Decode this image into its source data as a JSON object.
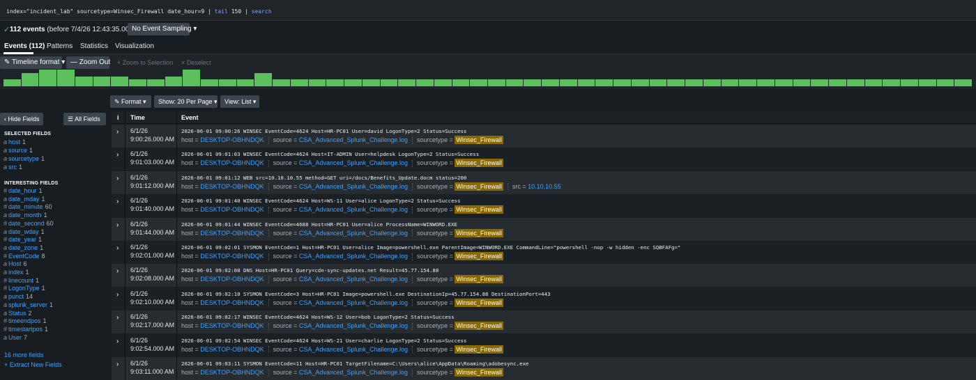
{
  "search": {
    "query": "index=\"incident_lab\" sourcetype=Winsec_Firewall date_hour=9 | ",
    "cmd1": "tail",
    "arg1": " 150 | ",
    "cmd2": "search"
  },
  "status": {
    "count_bold": "112 events",
    "count_rest": " (before 7/4/26 12:43:35.000 PM)",
    "sampling": "No Event Sampling ▾"
  },
  "tabs": [
    {
      "label": "Events (112)"
    },
    {
      "label": "Patterns"
    },
    {
      "label": "Statistics"
    },
    {
      "label": "Visualization"
    }
  ],
  "timeline": {
    "format": "Timeline format ▾",
    "zoom_out": "Zoom Out",
    "zoom_sel": "+ Zoom to Selection",
    "deselect": "× Deselect",
    "counts": [
      2,
      4,
      5,
      5,
      3,
      3,
      3,
      2,
      2,
      3,
      5,
      2,
      2,
      2,
      4,
      2,
      2,
      2,
      2,
      2,
      2,
      2,
      2,
      2,
      2,
      2,
      2,
      2,
      2,
      2,
      2,
      2,
      2,
      2,
      2,
      2,
      2,
      2,
      2,
      2,
      2,
      2,
      2,
      2,
      2,
      2,
      2,
      2,
      2,
      2,
      2,
      2,
      2,
      2
    ]
  },
  "toolbar": {
    "format": "Format ▾",
    "per_page": "Show: 20 Per Page ▾",
    "view": "View: List ▾"
  },
  "sidebar": {
    "hide": "Hide Fields",
    "all": "All Fields",
    "selected_heading": "SELECTED FIELDS",
    "selected": [
      {
        "type": "a",
        "name": "host",
        "count": "1"
      },
      {
        "type": "a",
        "name": "source",
        "count": "1"
      },
      {
        "type": "a",
        "name": "sourcetype",
        "count": "1"
      },
      {
        "type": "a",
        "name": "src",
        "count": "1"
      }
    ],
    "interesting_heading": "INTERESTING FIELDS",
    "interesting": [
      {
        "type": "#",
        "name": "date_hour",
        "count": "1"
      },
      {
        "type": "a",
        "name": "date_mday",
        "count": "1"
      },
      {
        "type": "#",
        "name": "date_minute",
        "count": "60"
      },
      {
        "type": "a",
        "name": "date_month",
        "count": "1"
      },
      {
        "type": "#",
        "name": "date_second",
        "count": "60"
      },
      {
        "type": "a",
        "name": "date_wday",
        "count": "1"
      },
      {
        "type": "#",
        "name": "date_year",
        "count": "1"
      },
      {
        "type": "a",
        "name": "date_zone",
        "count": "1"
      },
      {
        "type": "#",
        "name": "EventCode",
        "count": "8"
      },
      {
        "type": "a",
        "name": "Host",
        "count": "6"
      },
      {
        "type": "a",
        "name": "index",
        "count": "1"
      },
      {
        "type": "#",
        "name": "linecount",
        "count": "1"
      },
      {
        "type": "#",
        "name": "LogonType",
        "count": "1"
      },
      {
        "type": "a",
        "name": "punct",
        "count": "14"
      },
      {
        "type": "a",
        "name": "splunk_server",
        "count": "1"
      },
      {
        "type": "a",
        "name": "Status",
        "count": "2"
      },
      {
        "type": "#",
        "name": "timeendpos",
        "count": "1"
      },
      {
        "type": "#",
        "name": "timestartpos",
        "count": "1"
      },
      {
        "type": "a",
        "name": "User",
        "count": "7"
      }
    ],
    "more": "16 more fields",
    "extract": "+ Extract New Fields"
  },
  "table": {
    "col_i": "i",
    "col_time": "Time",
    "col_event": "Event",
    "meta_host_label": "host = ",
    "meta_source_label": "source = ",
    "meta_sourcetype_label": "sourcetype = ",
    "meta_src_label": "src = ",
    "host": "DESKTOP-OBHNDQK",
    "source": "CSA_Advanced_Splunk_Challenge.log",
    "sourcetype": "Winsec_Firewall",
    "rows": [
      {
        "date": "6/1/26",
        "time": "9:00:26.000 AM",
        "raw": "2026-06-01 09:00:26 WINSEC EventCode=4624 Host=HR-PC01 User=david LogonType=2 Status=Success"
      },
      {
        "date": "6/1/26",
        "time": "9:01:03.000 AM",
        "raw": "2026-06-01 09:01:03 WINSEC EventCode=4624 Host=IT-ADMIN User=helpdesk LogonType=2 Status=Success"
      },
      {
        "date": "6/1/26",
        "time": "9:01:12.000 AM",
        "raw": "2026-06-01 09:01:12 WEB src=10.10.10.55 method=GET uri=/docs/Benefits_Update.docm status=200",
        "src": "10.10.10.55"
      },
      {
        "date": "6/1/26",
        "time": "9:01:40.000 AM",
        "raw": "2026-06-01 09:01:40 WINSEC EventCode=4624 Host=WS-11 User=alice LogonType=2 Status=Success"
      },
      {
        "date": "6/1/26",
        "time": "9:01:44.000 AM",
        "raw": "2026-06-01 09:01:44 WINSEC EventCode=4688 Host=HR-PC01 User=alice ProcessName=WINWORD.EXE"
      },
      {
        "date": "6/1/26",
        "time": "9:02:01.000 AM",
        "raw": "2026-06-01 09:02:01 SYSMON EventCode=1 Host=HR-PC01 User=alice Image=powershell.exe ParentImage=WINWORD.EXE CommandLine=\"powershell -nop -w hidden -enc SQBFAFg=\""
      },
      {
        "date": "6/1/26",
        "time": "9:02:08.000 AM",
        "raw": "2026-06-01 09:02:08 DNS Host=HR-PC01 Query=cdn-sync-updates.net Result=45.77.154.88"
      },
      {
        "date": "6/1/26",
        "time": "9:02:10.000 AM",
        "raw": "2026-06-01 09:02:10 SYSMON EventCode=3 Host=HR-PC01 Image=powershell.exe DestinationIp=45.77.154.88 DestinationPort=443"
      },
      {
        "date": "6/1/26",
        "time": "9:02:17.000 AM",
        "raw": "2026-06-01 09:02:17 WINSEC EventCode=4624 Host=WS-12 User=bob LogonType=2 Status=Success"
      },
      {
        "date": "6/1/26",
        "time": "9:02:54.000 AM",
        "raw": "2026-06-01 09:02:54 WINSEC EventCode=4624 Host=WS-21 User=charlie LogonType=2 Status=Success"
      },
      {
        "date": "6/1/26",
        "time": "9:03:11.000 AM",
        "raw": "2026-06-01 09:03:11 SYSMON EventCode=11 Host=HR-PC01 TargetFilename=C:\\Users\\alice\\AppData\\Roaming\\adobesync.exe"
      }
    ]
  },
  "colors": {
    "accent_green": "#5cc05c",
    "link_blue": "#3ea2ff",
    "highlight": "#8a6a00"
  }
}
